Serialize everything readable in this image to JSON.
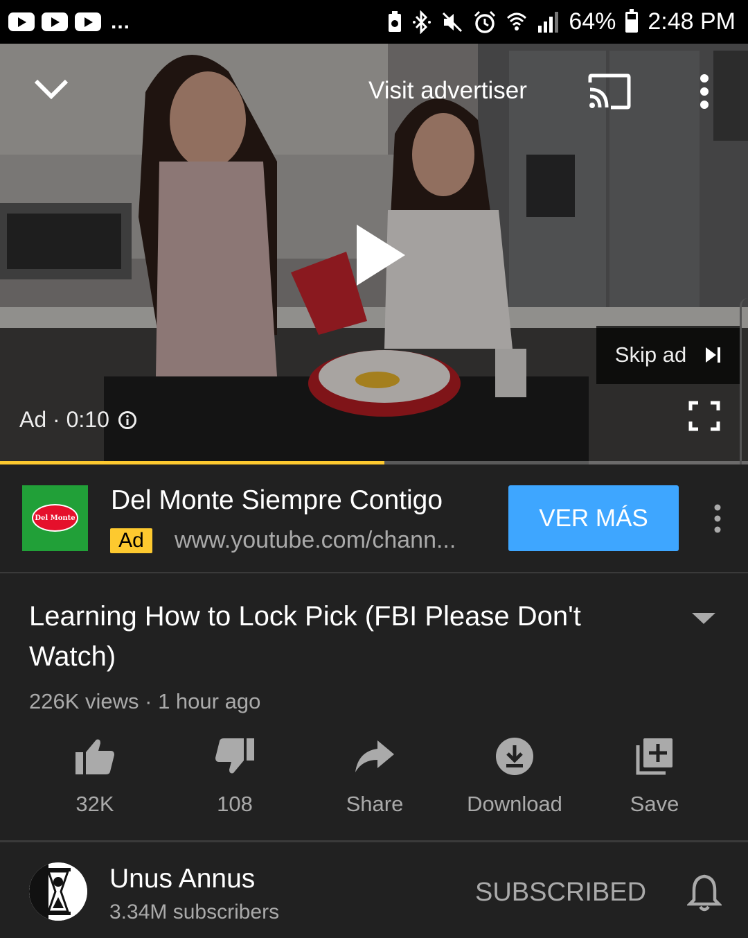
{
  "status_bar": {
    "notification_overflow": "...",
    "battery": "64%",
    "time": "2:48 PM"
  },
  "player": {
    "visit_advertiser": "Visit advertiser",
    "skip_ad": "Skip ad",
    "ad_time": "Ad · 0:10",
    "ad_progress": 0.514,
    "icons": [
      "chevron-down-icon",
      "cast-icon",
      "more-vert-icon",
      "play-icon",
      "skip-next-icon",
      "info-icon",
      "fullscreen-icon"
    ]
  },
  "ad": {
    "logo_text": "Del Monte",
    "title": "Del Monte Siempre Contigo",
    "badge": "Ad",
    "url": "www.youtube.com/chann...",
    "cta": "VER MÁS"
  },
  "video": {
    "title": "Learning How to Lock Pick (FBI Please Don't Watch)",
    "meta": "226K views · 1 hour ago"
  },
  "actions": [
    {
      "label": "32K",
      "icon": "thumbs-up-icon"
    },
    {
      "label": "108",
      "icon": "thumbs-down-icon"
    },
    {
      "label": "Share",
      "icon": "share-icon"
    },
    {
      "label": "Download",
      "icon": "download-icon"
    },
    {
      "label": "Save",
      "icon": "save-playlist-icon"
    }
  ],
  "channel": {
    "name": "Unus Annus",
    "subscribers": "3.34M subscribers",
    "subscribe_state": "SUBSCRIBED"
  },
  "colors": {
    "background": "#212121",
    "accent_blue": "#3ea6ff",
    "ad_yellow": "#fdc92f",
    "secondary_text": "#aaaaaa"
  }
}
